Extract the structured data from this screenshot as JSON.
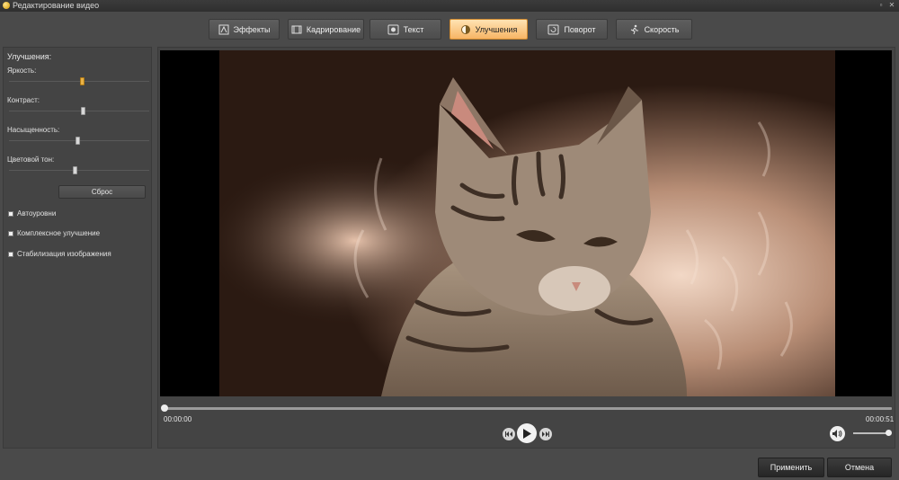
{
  "window": {
    "title": "Редактирование видео"
  },
  "tabs": [
    {
      "label": "Эффекты",
      "icon": "effects-icon",
      "active": false
    },
    {
      "label": "Кадрирование",
      "icon": "crop-icon",
      "active": false
    },
    {
      "label": "Текст",
      "icon": "text-icon",
      "active": false
    },
    {
      "label": "Улучшения",
      "icon": "enhance-icon",
      "active": true
    },
    {
      "label": "Поворот",
      "icon": "rotate-icon",
      "active": false
    },
    {
      "label": "Скорость",
      "icon": "speed-icon",
      "active": false
    }
  ],
  "enhance_panel": {
    "heading": "Улучшения:",
    "sliders": [
      {
        "label": "Яркость:",
        "value": 0.55
      },
      {
        "label": "Контраст:",
        "value": 0.5
      },
      {
        "label": "Насыщенность:",
        "value": 0.5
      },
      {
        "label": "Цветовой тон:",
        "value": 0.5
      }
    ],
    "reset_label": "Сброс",
    "checkboxes": [
      {
        "label": "Автоуровни",
        "checked": false
      },
      {
        "label": "Комплексное улучшение",
        "checked": false
      },
      {
        "label": "Стабилизация изображения",
        "checked": false
      }
    ]
  },
  "player": {
    "time_current": "00:00:00",
    "time_total": "00:00:51",
    "progress": 0,
    "volume": 0.9
  },
  "actions": {
    "apply_label": "Применить",
    "cancel_label": "Отмена"
  },
  "colors": {
    "accent_active_tab": "#f7b565",
    "panel_bg": "#444444"
  }
}
